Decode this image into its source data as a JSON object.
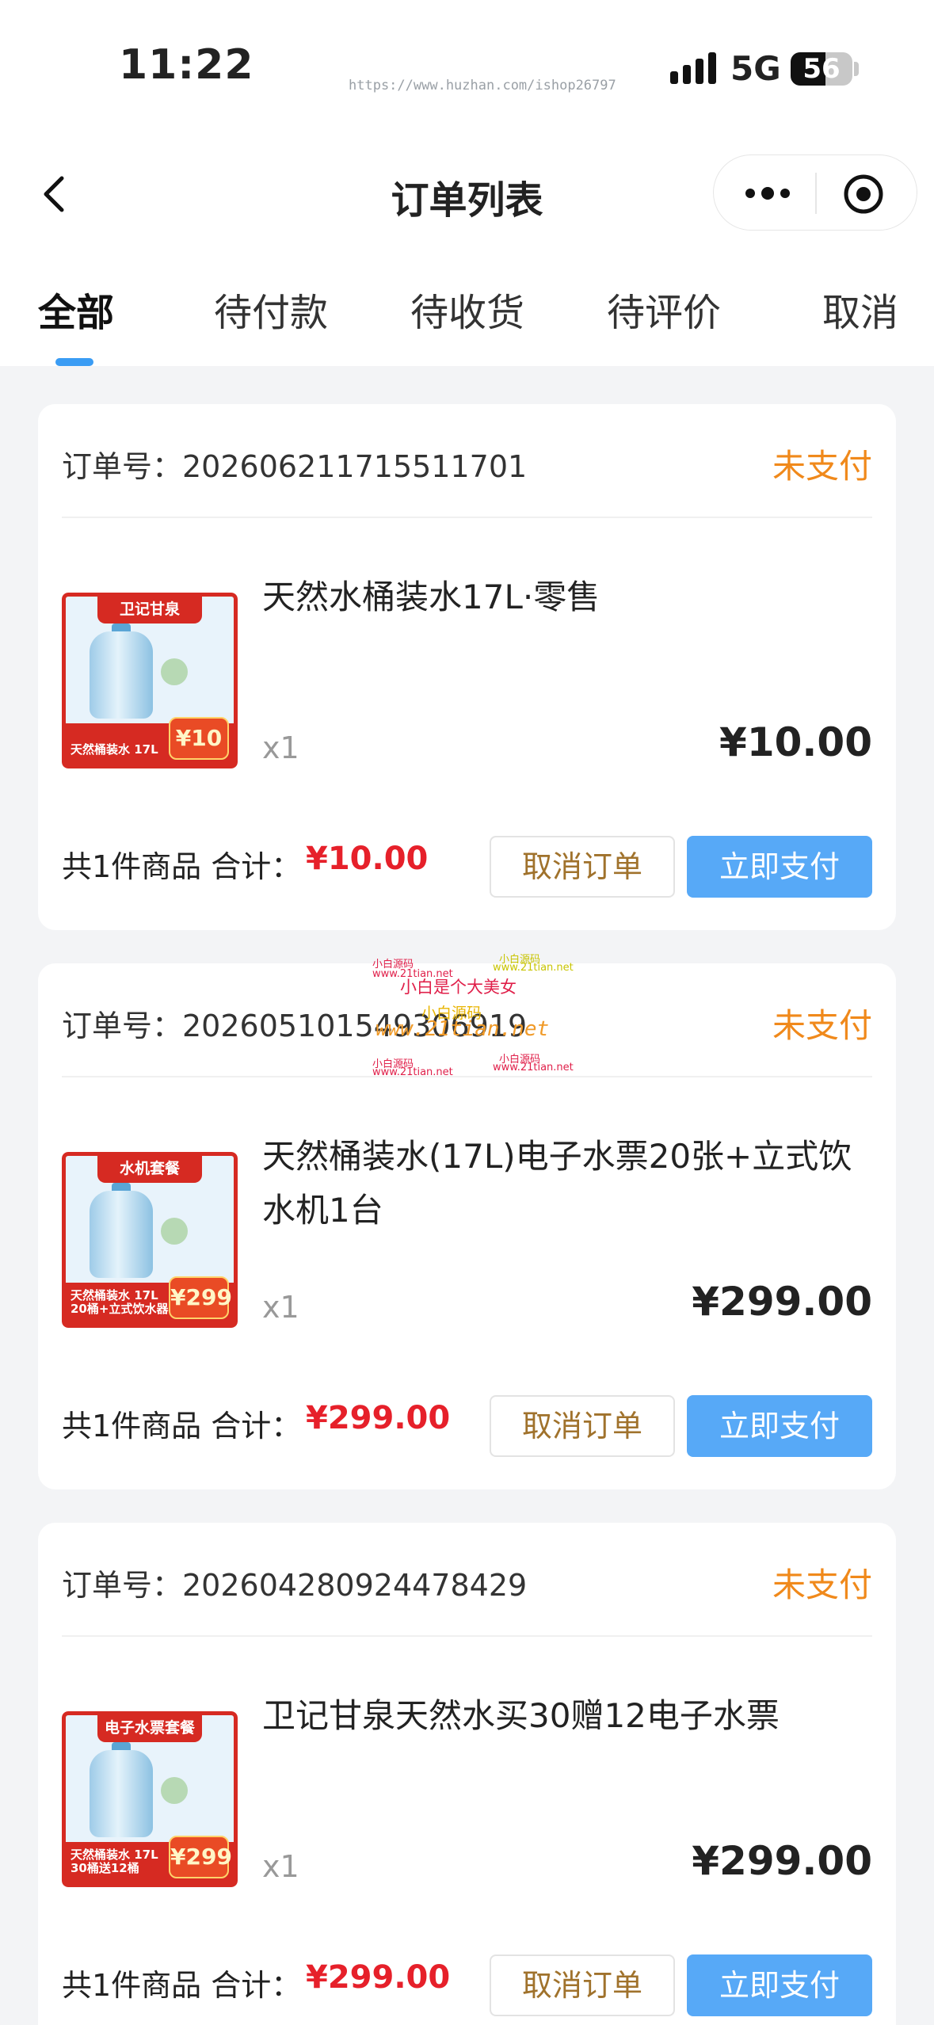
{
  "status_bar": {
    "time": "11:22",
    "url_watermark": "https://www.huzhan.com/ishop26797",
    "network": "5G",
    "battery_level": 56,
    "battery_text": "56"
  },
  "nav": {
    "title": "订单列表"
  },
  "tabs": [
    {
      "label": "全部",
      "active": true
    },
    {
      "label": "待付款",
      "active": false
    },
    {
      "label": "待收货",
      "active": false
    },
    {
      "label": "待评价",
      "active": false
    },
    {
      "label": "取消",
      "active": false
    }
  ],
  "orders": [
    {
      "order_no": "订单号：202606211715511701",
      "status": "未支付",
      "product_name": "天然水桶装水17L·零售",
      "quantity": "x1",
      "price": "¥10.00",
      "summary": "共1件商品  合计：",
      "total": "¥10.00",
      "cancel_label": "取消订单",
      "pay_label": "立即支付",
      "image": {
        "top_label": "卫记甘泉",
        "band_text": "天然桶装水 17L",
        "band_text2": "",
        "tag": "¥10"
      }
    },
    {
      "order_no": "订单号：202605101549306919",
      "status": "未支付",
      "product_name": "天然桶装水(17L)电子水票20张+立式饮水机1台",
      "quantity": "x1",
      "price": "¥299.00",
      "summary": "共1件商品  合计：",
      "total": "¥299.00",
      "cancel_label": "取消订单",
      "pay_label": "立即支付",
      "image": {
        "top_label": "水机套餐",
        "band_text": "天然桶装水 17L",
        "band_text2": "20桶+立式饮水器1台",
        "tag": "¥299"
      }
    },
    {
      "order_no": "订单号：202604280924478429",
      "status": "未支付",
      "product_name": "卫记甘泉天然水买30赠12电子水票",
      "quantity": "x1",
      "price": "¥299.00",
      "summary": "共1件商品  合计：",
      "total": "¥299.00",
      "cancel_label": "取消订单",
      "pay_label": "立即支付",
      "image": {
        "top_label": "电子水票套餐",
        "band_text": "天然桶装水 17L",
        "band_text2": "30桶送12桶",
        "tag": "¥299"
      }
    }
  ],
  "watermark": {
    "line1": "小白源码",
    "line2": "小白是个大美女",
    "line3": "www.21tian.net",
    "small": "www.21tian.net"
  },
  "colors": {
    "accent": "#3a9cf4",
    "pay_button": "#57a9f7",
    "status": "#f0891b",
    "total": "#e6202a",
    "cancel_text": "#a0722c"
  },
  "icons": [
    "back-icon",
    "more-icon",
    "close-capsule-icon",
    "signal-icon",
    "battery-icon"
  ]
}
